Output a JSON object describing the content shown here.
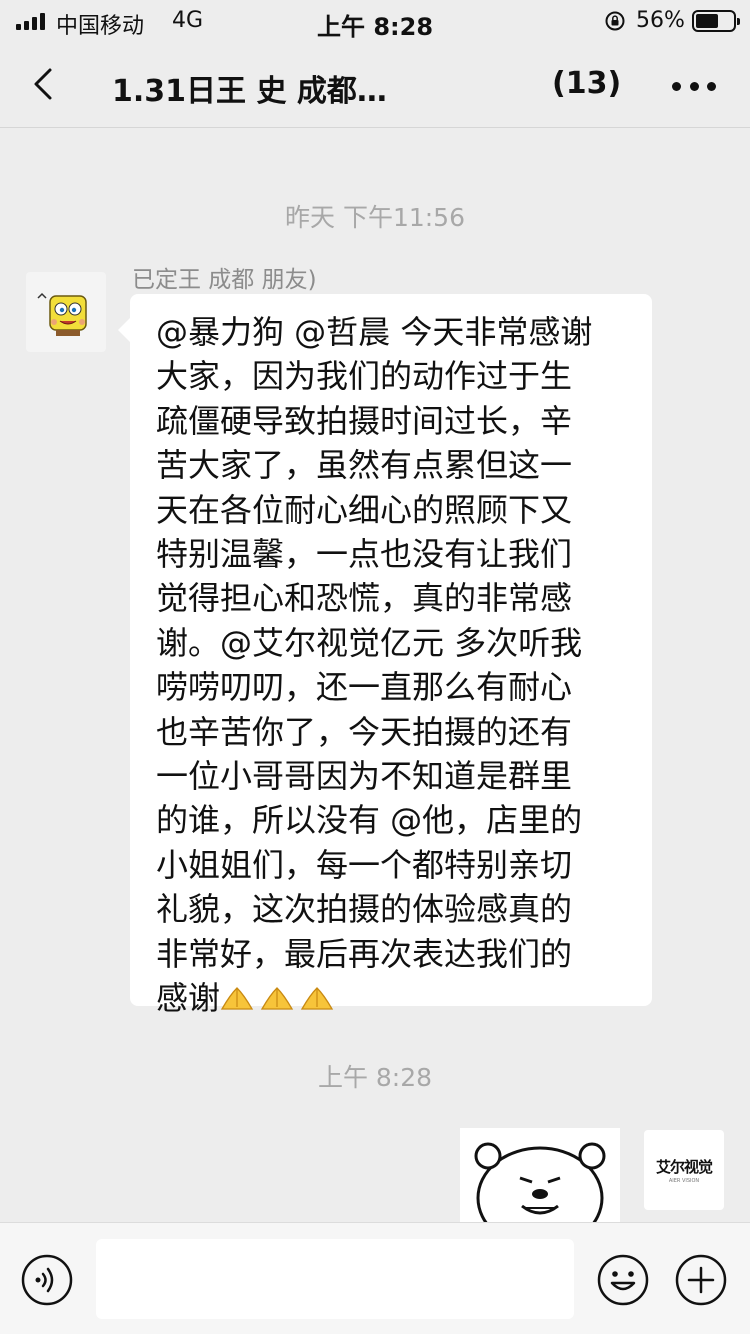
{
  "status_bar": {
    "carrier": "中国移动",
    "network": "4G",
    "time": "上午 8:28",
    "battery": "56%",
    "icons": [
      "signal-icon",
      "rotation-lock-icon",
      "battery-icon"
    ]
  },
  "nav": {
    "title": "1.31日王  史  成都…",
    "member_count": "(13)",
    "icons": [
      "back-arrow-icon",
      "more-dots-icon"
    ]
  },
  "chat": {
    "timestamp_1": "昨天 下午11:56",
    "sender_name": "已定王  成都     朋友)",
    "message_lines": [
      "@暴力狗 @哲晨  今天非常感谢",
      "大家，因为我们的动作过于生",
      "疏僵硬导致拍摄时间过长，辛",
      "苦大家了，虽然有点累但这一",
      "天在各位耐心细心的照顾下又",
      "特别温馨，一点也没有让我们",
      "觉得担心和恐慌，真的非常感",
      "谢。@艾尔视觉亿元 多次听我",
      "唠唠叨叨，还一直那么有耐心",
      "也辛苦你了，今天拍摄的还有",
      "一位小哥哥因为不知道是群里",
      "的谁，所以没有 @他，店里的",
      "小姐姐们，每一个都特别亲切",
      "礼貌，这次拍摄的体验感真的",
      "非常好，最后再次表达我们的"
    ],
    "message_last_line": "感谢",
    "emoji_names": [
      "pray-emoji",
      "pray-emoji",
      "pray-emoji"
    ],
    "timestamp_2": "上午 8:28",
    "right_avatar_logo": "艾尔视觉",
    "right_avatar_logo_sub": "AIER VISION"
  },
  "input_bar": {
    "message_value": "",
    "icons": [
      "voice-icon",
      "emoji-icon",
      "plus-icon"
    ]
  },
  "colors": {
    "background": "#ededed",
    "bubble": "#ffffff",
    "timestamp": "#a8a8a8",
    "sender_name": "#8c8c8c"
  }
}
